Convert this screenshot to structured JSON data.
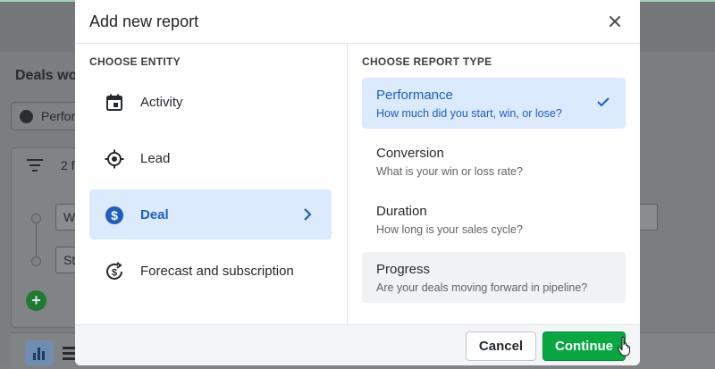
{
  "background": {
    "page_title": "Deals wo",
    "pill_text": "Perfor",
    "filter_count": "2 f",
    "field_1": "W",
    "field_2": "St"
  },
  "modal": {
    "title": "Add new report",
    "close_icon": "close-icon",
    "entity_section_label": "CHOOSE ENTITY",
    "entities": [
      {
        "label": "Activity",
        "icon": "calendar-icon",
        "selected": false
      },
      {
        "label": "Lead",
        "icon": "target-icon",
        "selected": false
      },
      {
        "label": "Deal",
        "icon": "dollar-circle-icon",
        "selected": true
      },
      {
        "label": "Forecast and subscription",
        "icon": "forecast-dollar-icon",
        "selected": false
      }
    ],
    "report_section_label": "CHOOSE REPORT TYPE",
    "report_types": [
      {
        "title": "Performance",
        "description": "How much did you start, win, or lose?",
        "selected": true
      },
      {
        "title": "Conversion",
        "description": "What is your win or loss rate?",
        "selected": false
      },
      {
        "title": "Duration",
        "description": "How long is your sales cycle?",
        "selected": false
      },
      {
        "title": "Progress",
        "description": "Are your deals moving forward in pipeline?",
        "selected": false,
        "hovered": true
      }
    ],
    "cancel_label": "Cancel",
    "continue_label": "Continue"
  },
  "colors": {
    "accent_blue": "#1e5fbe",
    "selected_bg": "#dbeafd",
    "continue_green": "#08a742"
  }
}
